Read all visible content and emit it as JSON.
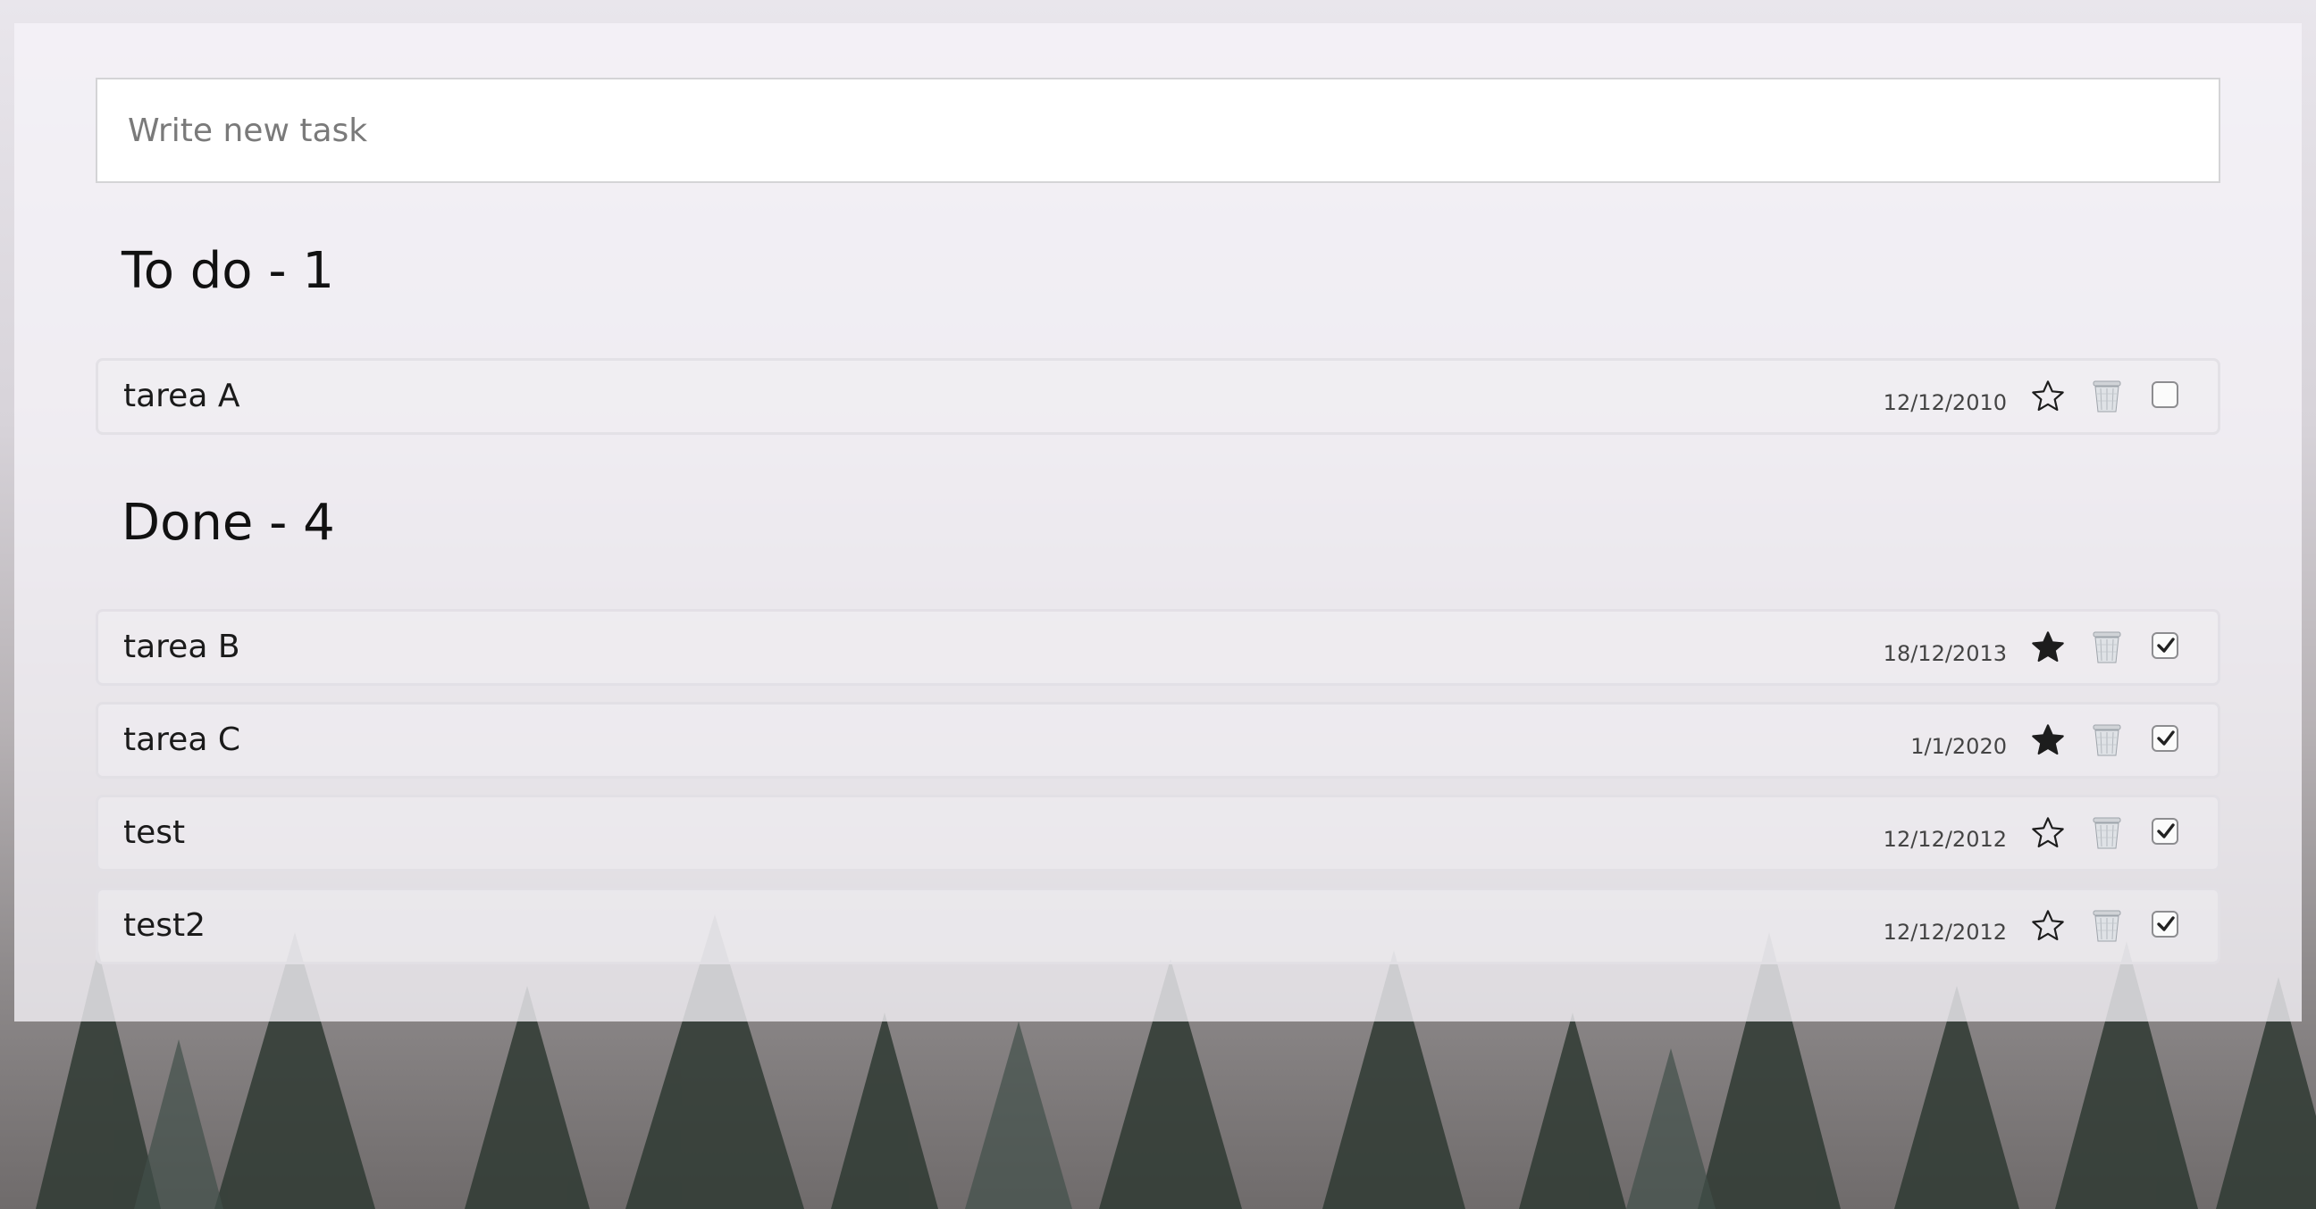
{
  "input": {
    "placeholder": "Write new task",
    "value": ""
  },
  "todo": {
    "title": "To do - 1",
    "tasks": [
      {
        "name": "tarea A",
        "date": "12/12/2010",
        "starred": false,
        "done": false
      }
    ]
  },
  "done": {
    "title": "Done - 4",
    "tasks": [
      {
        "name": "tarea B",
        "date": "18/12/2013",
        "starred": true,
        "done": true
      },
      {
        "name": "tarea C",
        "date": "1/1/2020",
        "starred": true,
        "done": true
      },
      {
        "name": "test",
        "date": "12/12/2012",
        "starred": false,
        "done": true
      },
      {
        "name": "test2",
        "date": "12/12/2012",
        "starred": false,
        "done": true
      }
    ]
  },
  "icons": {
    "star": "star-icon",
    "trash": "trash-icon",
    "check": "checkbox-icon"
  },
  "colors": {
    "panel": "#f6f4f8",
    "text": "#111111",
    "border": "#d4d4d6"
  }
}
